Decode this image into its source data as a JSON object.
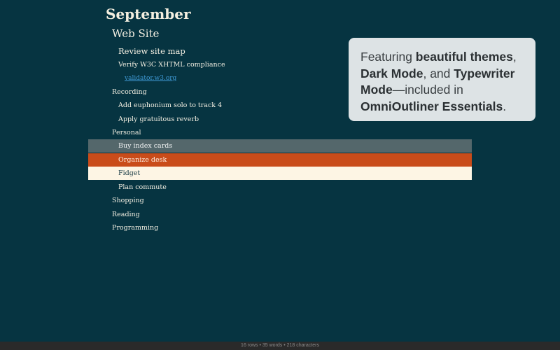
{
  "outline": {
    "title": "September",
    "rows": [
      {
        "text": "Web Site",
        "level": 1
      },
      {
        "text": "Review site map",
        "level": 2
      },
      {
        "text": "Verify W3C XHTML compliance",
        "level": 2
      },
      {
        "text": "validator.w3.org",
        "level": 3,
        "link": true
      },
      {
        "text": "Recording",
        "level": 1
      },
      {
        "text": "Add euphonium solo to track 4",
        "level": 2
      },
      {
        "text": "Apply gratuitous reverb",
        "level": 2
      },
      {
        "text": "Personal",
        "level": 1
      },
      {
        "text": "Buy index cards",
        "level": 2
      },
      {
        "text": "Organize desk",
        "level": 2
      },
      {
        "text": "Fidget",
        "level": 2
      },
      {
        "text": "Plan commute",
        "level": 2
      },
      {
        "text": "Shopping",
        "level": 1
      },
      {
        "text": "Reading",
        "level": 1
      },
      {
        "text": "Programming",
        "level": 1
      }
    ]
  },
  "callout": {
    "t1": "Featuring ",
    "b1": "beautiful themes",
    "t2": ",",
    "b2": "Dark Mode",
    "t3": ", and ",
    "b3": "Typewriter Mode",
    "t4": "—included in",
    "b4": "OmniOutliner Essentials",
    "t5": "."
  },
  "status": {
    "text": "16 rows • 35 words • 218 characters"
  },
  "colors": {
    "background": "#063441",
    "row_gray": "#54676b",
    "row_orange": "#c94c1a",
    "row_cream": "#fdf5e4",
    "link": "#3f9ad6"
  }
}
